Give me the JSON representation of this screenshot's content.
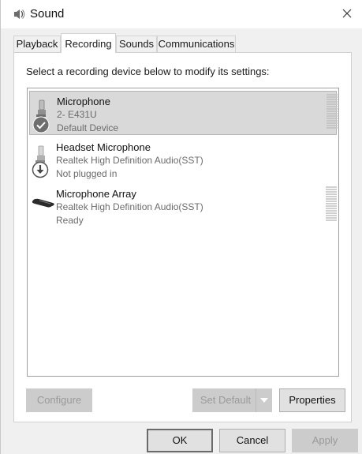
{
  "window": {
    "title": "Sound"
  },
  "tabs": [
    {
      "label": "Playback",
      "active": false
    },
    {
      "label": "Recording",
      "active": true
    },
    {
      "label": "Sounds",
      "active": false
    },
    {
      "label": "Communications",
      "active": false
    }
  ],
  "instruction": "Select a recording device below to modify its settings:",
  "devices": [
    {
      "name": "Microphone",
      "driver": "2- E431U",
      "status": "Default Device",
      "selected": true,
      "status_icon": "check-icon"
    },
    {
      "name": "Headset Microphone",
      "driver": "Realtek High Definition Audio(SST)",
      "status": "Not plugged in",
      "selected": false,
      "status_icon": "down-arrow-icon"
    },
    {
      "name": "Microphone Array",
      "driver": "Realtek High Definition Audio(SST)",
      "status": "Ready",
      "selected": false,
      "status_icon": ""
    }
  ],
  "buttons": {
    "configure": "Configure",
    "set_default": "Set Default",
    "properties": "Properties",
    "ok": "OK",
    "cancel": "Cancel",
    "apply": "Apply"
  },
  "colors": {
    "selected_row": "#d9d9d9",
    "check_badge": "#6e6e6e",
    "disabled_button": "#cccccc"
  }
}
